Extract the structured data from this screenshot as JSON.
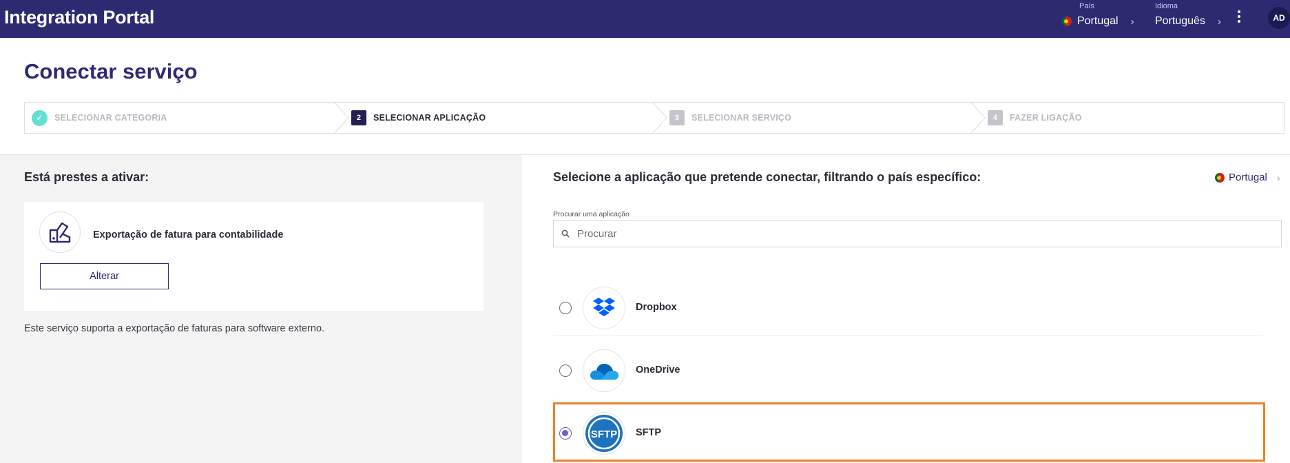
{
  "header": {
    "brand": "Integration Portal",
    "country_caption": "País",
    "country_value": "Portugal",
    "language_caption": "Idioma",
    "language_value": "Português",
    "avatar_initials": "AD",
    "chevron": "›"
  },
  "page": {
    "title": "Conectar serviço"
  },
  "stepper": {
    "steps": [
      {
        "label": "SELECIONAR CATEGORIA",
        "number": "",
        "state": "done"
      },
      {
        "label": "SELECIONAR APLICAÇÃO",
        "number": "2",
        "state": "active"
      },
      {
        "label": "SELECIONAR SERVIÇO",
        "number": "3",
        "state": "pending"
      },
      {
        "label": "FAZER LIGAÇÃO",
        "number": "4",
        "state": "pending"
      }
    ]
  },
  "left": {
    "heading": "Está prestes a ativar:",
    "service_title": "Exportação de fatura para contabilidade",
    "change_button": "Alterar",
    "description": "Este serviço suporta a exportação de faturas para software externo."
  },
  "right": {
    "heading": "Selecione a aplicação que pretende conectar, filtrando o país específico:",
    "country": "Portugal",
    "chevron": "›",
    "search_label": "Procurar uma aplicação",
    "search_placeholder": "Procurar",
    "apps": [
      {
        "name": "Dropbox",
        "selected": false,
        "icon": "dropbox-icon"
      },
      {
        "name": "OneDrive",
        "selected": false,
        "icon": "onedrive-icon"
      },
      {
        "name": "SFTP",
        "selected": true,
        "icon": "sftp-icon",
        "logo_text": "SFTP"
      }
    ]
  },
  "colors": {
    "header_bg": "#2e2a72",
    "accent": "#2e2a72",
    "highlight": "#f07f22",
    "step_done": "#63e0cf",
    "radio_selected": "#6b5fd0"
  }
}
